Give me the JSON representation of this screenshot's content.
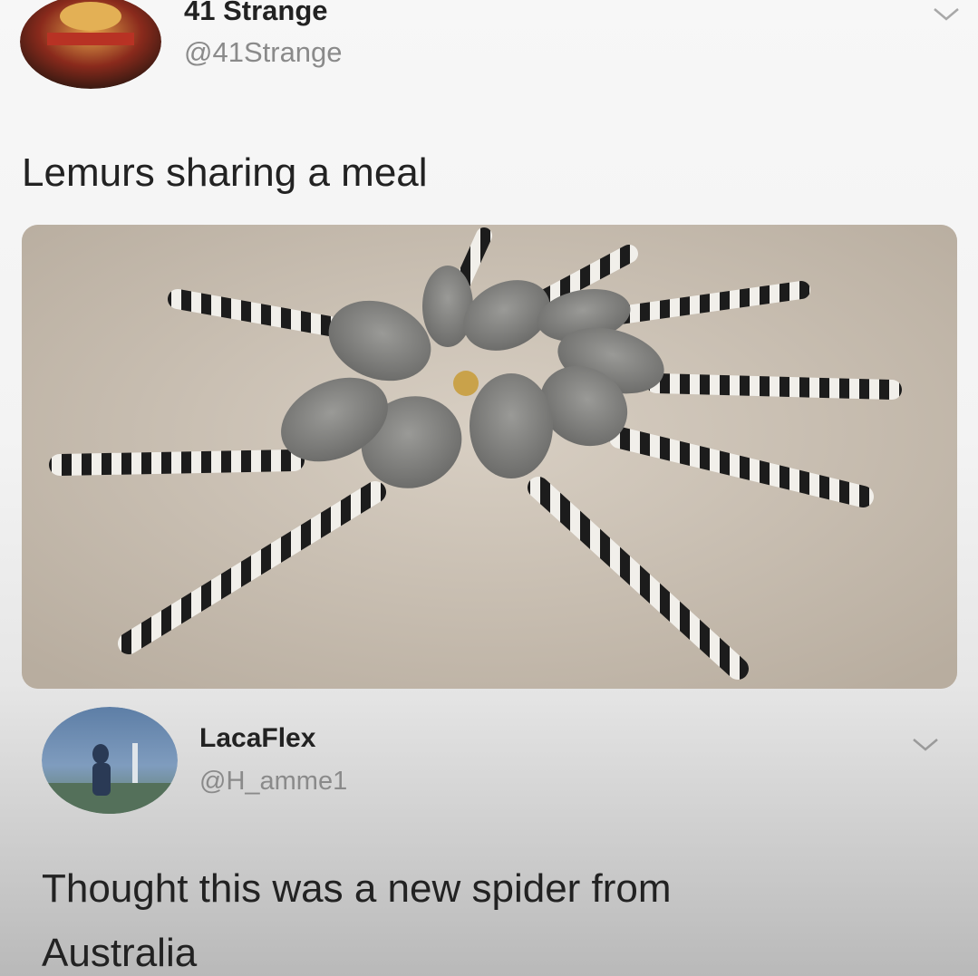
{
  "tweet": {
    "author_name": "41 Strange",
    "author_handle": "@41Strange",
    "text": "Lemurs sharing a meal",
    "menu_icon": "chevron-down-icon",
    "media_icon": "photo"
  },
  "reply": {
    "author_name": "LacaFlex",
    "author_handle": "@H_amme1",
    "text_line1": "Thought this was a new spider from",
    "text_line2": "Australia",
    "menu_icon": "chevron-down-icon"
  },
  "colors": {
    "name": "#222222",
    "handle": "#8a8a8a",
    "background": "#f5f5f5"
  }
}
